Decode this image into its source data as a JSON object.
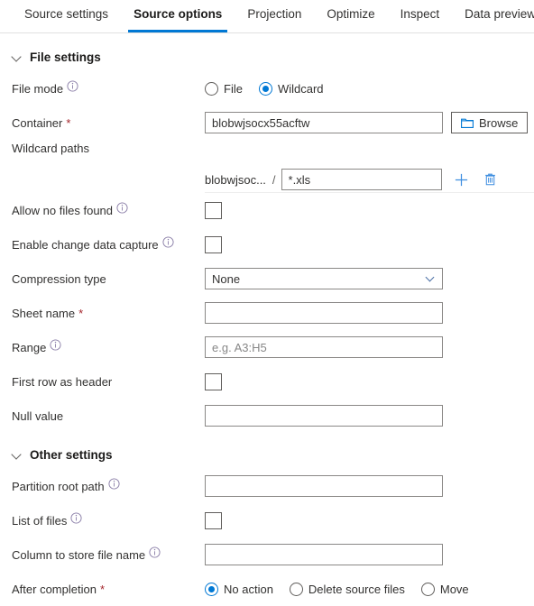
{
  "tabs": [
    {
      "label": "Source settings",
      "active": false
    },
    {
      "label": "Source options",
      "active": true
    },
    {
      "label": "Projection",
      "active": false
    },
    {
      "label": "Optimize",
      "active": false
    },
    {
      "label": "Inspect",
      "active": false
    },
    {
      "label": "Data preview",
      "active": false
    }
  ],
  "colors": {
    "accent": "#0078d4",
    "required": "#a4262c",
    "text": "#323130",
    "border": "#8a8886"
  },
  "sections": {
    "file_settings": {
      "title": "File settings",
      "collapse_icon": "chevron-down-icon"
    },
    "other_settings": {
      "title": "Other settings",
      "collapse_icon": "chevron-down-icon"
    }
  },
  "fields": {
    "file_mode": {
      "label": "File mode",
      "info_icon": "info-icon",
      "options": [
        {
          "label": "File",
          "selected": false
        },
        {
          "label": "Wildcard",
          "selected": true
        }
      ]
    },
    "container": {
      "label": "Container",
      "required": "*",
      "value": "blobwjsocx55acftw",
      "placeholder": "",
      "browse_label": "Browse",
      "browse_icon": "folder-icon"
    },
    "wildcard_paths": {
      "label": "Wildcard paths",
      "prefix": "blobwjsoc...",
      "separator": "/",
      "value": "*.xls",
      "placeholder": "",
      "add_icon": "plus-icon",
      "delete_icon": "trash-icon"
    },
    "allow_no_files_found": {
      "label": "Allow no files found",
      "info_icon": "info-icon",
      "checked": false
    },
    "enable_change_data_capture": {
      "label": "Enable change data capture",
      "info_icon": "info-icon",
      "checked": false
    },
    "compression_type": {
      "label": "Compression type",
      "value": "None",
      "chevron_icon": "chevron-down-icon"
    },
    "sheet_name": {
      "label": "Sheet name",
      "required": "*",
      "value": "",
      "placeholder": ""
    },
    "range": {
      "label": "Range",
      "info_icon": "info-icon",
      "value": "",
      "placeholder": "e.g. A3:H5"
    },
    "first_row_as_header": {
      "label": "First row as header",
      "checked": false
    },
    "null_value": {
      "label": "Null value",
      "value": "",
      "placeholder": ""
    },
    "partition_root_path": {
      "label": "Partition root path",
      "info_icon": "info-icon",
      "value": "",
      "placeholder": ""
    },
    "list_of_files": {
      "label": "List of files",
      "info_icon": "info-icon",
      "checked": false
    },
    "column_to_store_file_name": {
      "label": "Column to store file name",
      "info_icon": "info-icon",
      "value": "",
      "placeholder": ""
    },
    "after_completion": {
      "label": "After completion",
      "required": "*",
      "options": [
        {
          "label": "No action",
          "selected": true
        },
        {
          "label": "Delete source files",
          "selected": false
        },
        {
          "label": "Move",
          "selected": false
        }
      ]
    }
  }
}
